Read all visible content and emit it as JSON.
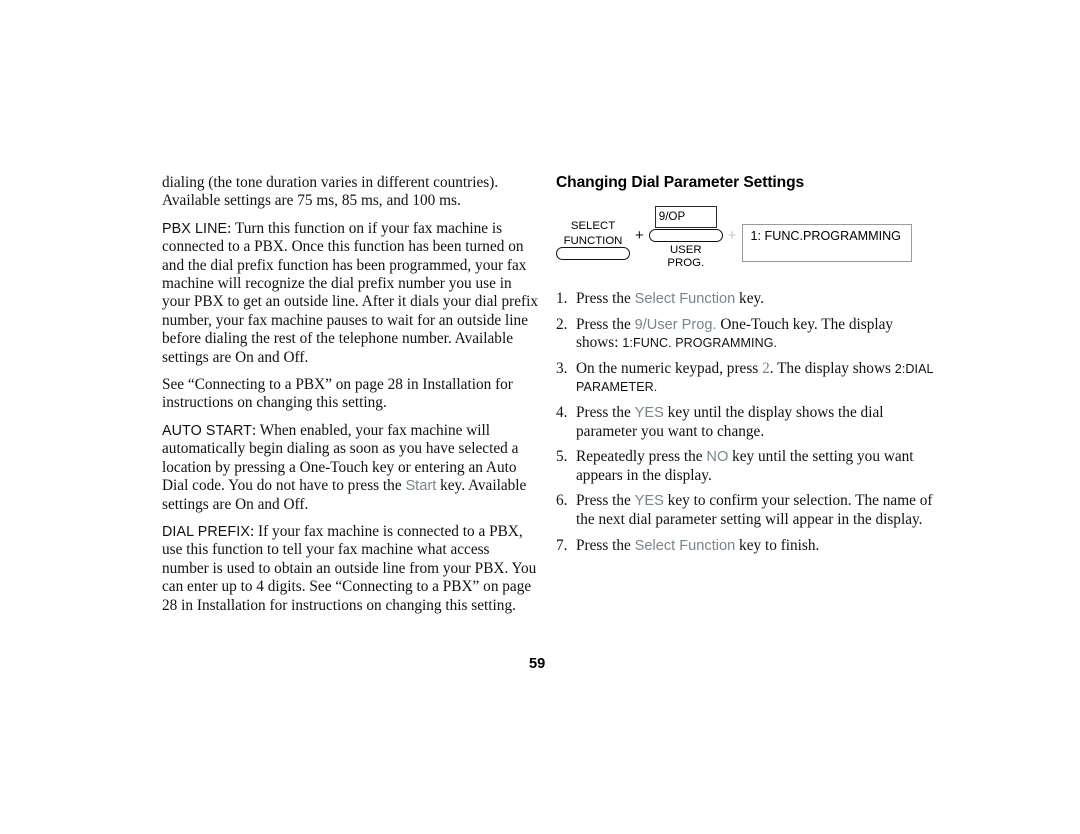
{
  "page": {
    "number": "59",
    "background_color": "#ffffff",
    "text_color": "#121212",
    "accent_color": "#75868f"
  },
  "left_column": {
    "paragraphs": [
      {
        "id": "p-dialing",
        "lead": "",
        "text": "dialing (the tone duration varies in different countries). Available settings are 75 ms, 85 ms, and 100 ms."
      },
      {
        "id": "p-pbx-line",
        "lead": "PBX LINE",
        "text": ": Turn this function on if your fax machine is connected to a PBX. Once this function has been turned on and the dial prefix function has been programmed, your fax machine will recognize the dial prefix number you use in your PBX to get an outside line. After it dials your dial prefix number, your fax machine pauses to wait for an outside line before dialing the rest of the telephone number. Available settings are On and Off."
      },
      {
        "id": "p-see-connecting",
        "lead": "",
        "text": "See “Connecting to a PBX” on page 28 in Installation for instructions on changing this setting."
      },
      {
        "id": "p-auto-start",
        "lead": "AUTO START",
        "text_before_key": ": When enabled, your fax machine will automatically begin dialing as soon as you have selected a location by pressing a One-Touch key or entering an Auto Dial code. You do not have to press the ",
        "key": "Start",
        "text_after_key": " key. Available settings are On and Off."
      },
      {
        "id": "p-dial-prefix",
        "lead": "DIAL PREFIX",
        "text": ": If your fax machine is connected to a PBX, use this function to tell your fax machine what access number is used to obtain an outside line from your PBX. You can enter up to 4 digits. See “Connecting to a PBX” on page 28 in Installation for instructions on changing this setting."
      }
    ]
  },
  "right_column": {
    "heading": "Changing Dial Parameter Settings",
    "key_diagram": {
      "select_function": {
        "caption_line1": "SELECT",
        "caption_line2": "FUNCTION",
        "key_shape": "pill-button"
      },
      "plus1": "+",
      "user_prog": {
        "box_label": "9/OP",
        "caption_line1": "USER",
        "caption_line2": "PROG.",
        "key_shape": "pill-button"
      },
      "plus2": "+",
      "display": {
        "text": "1: FUNC.PROGRAMMING"
      }
    },
    "steps": [
      {
        "number": "1.",
        "parts": [
          {
            "type": "text",
            "value": "Press the "
          },
          {
            "type": "key",
            "value": "Select Function"
          },
          {
            "type": "text",
            "value": "  key."
          }
        ]
      },
      {
        "number": "2.",
        "parts": [
          {
            "type": "text",
            "value": "Press the "
          },
          {
            "type": "key",
            "value": "9/User Prog."
          },
          {
            "type": "text",
            "value": "  One-Touch key. The display shows: "
          },
          {
            "type": "lcd",
            "value": "1:FUNC. PROGRAMMING."
          }
        ]
      },
      {
        "number": "3.",
        "parts": [
          {
            "type": "text",
            "value": "On the numeric keypad, press "
          },
          {
            "type": "keynum",
            "value": "2"
          },
          {
            "type": "text",
            "value": ". The display shows "
          },
          {
            "type": "lcd",
            "value": "2:DIAL PARAMETER."
          }
        ]
      },
      {
        "number": "4.",
        "parts": [
          {
            "type": "text",
            "value": "Press the "
          },
          {
            "type": "key",
            "value": "YES"
          },
          {
            "type": "text",
            "value": " key until the display shows the dial parameter you want to change."
          }
        ]
      },
      {
        "number": "5.",
        "parts": [
          {
            "type": "text",
            "value": "Repeatedly press the "
          },
          {
            "type": "key",
            "value": "NO"
          },
          {
            "type": "text",
            "value": " key until the setting you want appears in the display."
          }
        ]
      },
      {
        "number": "6.",
        "parts": [
          {
            "type": "text",
            "value": "Press the "
          },
          {
            "type": "key",
            "value": "YES"
          },
          {
            "type": "text",
            "value": " key to confirm your selection. The name of the next dial parameter setting will appear in the display."
          }
        ]
      },
      {
        "number": "7.",
        "parts": [
          {
            "type": "text",
            "value": "Press the "
          },
          {
            "type": "key",
            "value": "Select Function"
          },
          {
            "type": "text",
            "value": "  key to finish."
          }
        ]
      }
    ]
  }
}
